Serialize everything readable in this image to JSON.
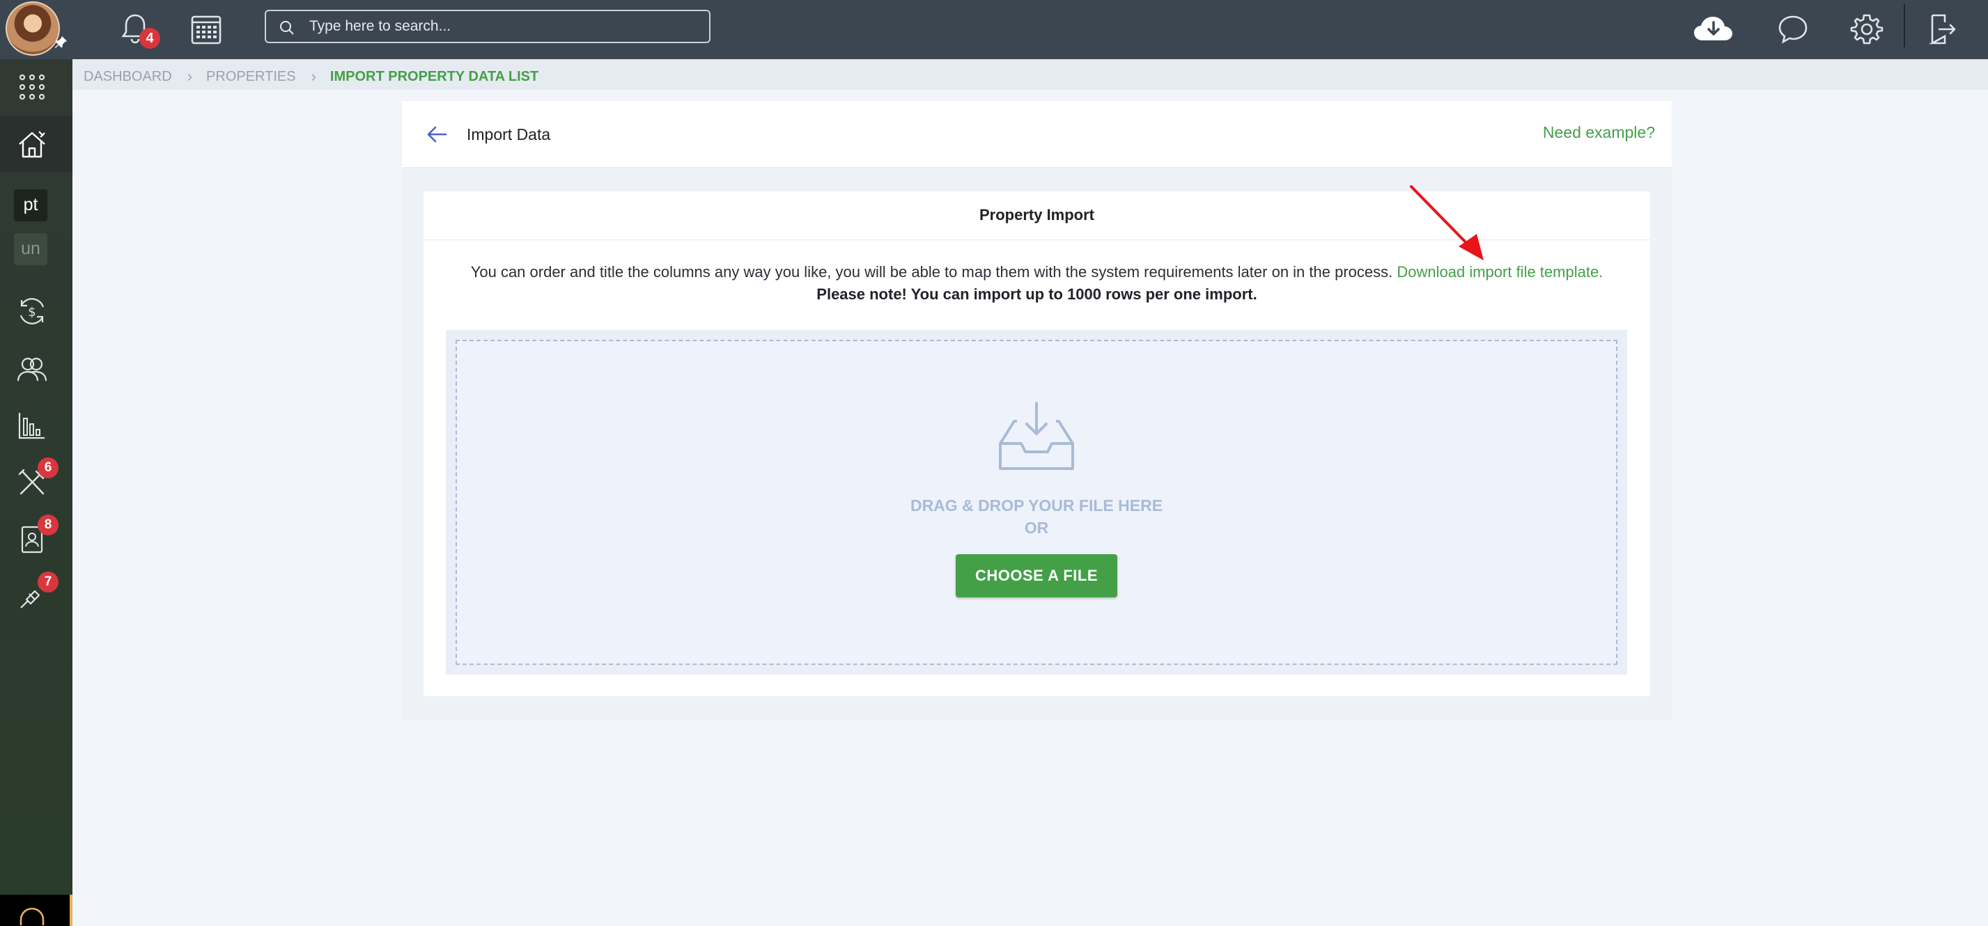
{
  "topbar": {
    "notifications_count": "4",
    "search_placeholder": "Type here to search..."
  },
  "sidebar": {
    "chips": [
      {
        "label": "pt"
      },
      {
        "label": "un"
      }
    ],
    "badges": {
      "tools": "6",
      "contacts": "8",
      "links": "7"
    }
  },
  "breadcrumb": {
    "items": [
      "DASHBOARD",
      "PROPERTIES"
    ],
    "current": "IMPORT PROPERTY DATA LIST"
  },
  "header": {
    "title": "Import Data",
    "need_example": "Need example?"
  },
  "import": {
    "section_title": "Property Import",
    "info_text": "You can order and title the columns any way you like, you will be able to map them with the system requirements later on in the process.",
    "template_link": "Download import file template.",
    "note": "Please note! You can import up to 1000 rows per one import.",
    "drop_line1": "DRAG & DROP YOUR FILE HERE",
    "drop_line2": "OR",
    "choose_button": "CHOOSE A FILE"
  },
  "colors": {
    "accent": "#43a047",
    "topbar": "#3c4650",
    "badge": "#d9363e",
    "annotation_arrow": "#e8141a"
  }
}
